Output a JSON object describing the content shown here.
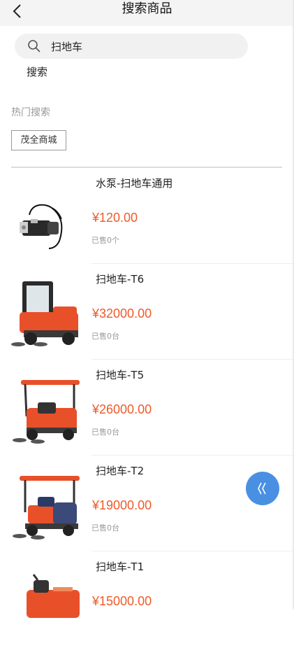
{
  "header": {
    "title": "搜索商品",
    "back_icon": "chevron-left-icon"
  },
  "search": {
    "value": "扫地车",
    "placeholder": "",
    "icon": "search-icon",
    "button_label": "搜索"
  },
  "hot": {
    "title": "热门搜索",
    "tags": [
      "茂全商城"
    ]
  },
  "products": [
    {
      "name": "水泵-扫地车通用",
      "price": "¥120.00",
      "sold": "已售0个",
      "image": "water-pump"
    },
    {
      "name": "扫地车-T6",
      "price": "¥32000.00",
      "sold": "已售0台",
      "image": "cab-sweeper"
    },
    {
      "name": "扫地车-T5",
      "price": "¥26000.00",
      "sold": "已售0台",
      "image": "canopy-sweeper"
    },
    {
      "name": "扫地车-T2",
      "price": "¥19000.00",
      "sold": "已售0台",
      "image": "canopy-sweeper-blue"
    },
    {
      "name": "扫地车-T1",
      "price": "¥15000.00",
      "sold": "",
      "image": "open-sweeper"
    }
  ],
  "float_button": {
    "icon": "double-chevron-left-icon"
  },
  "colors": {
    "price": "#ef5a2a",
    "float_button": "#4a90e2",
    "accent_red": "#e8502a"
  }
}
